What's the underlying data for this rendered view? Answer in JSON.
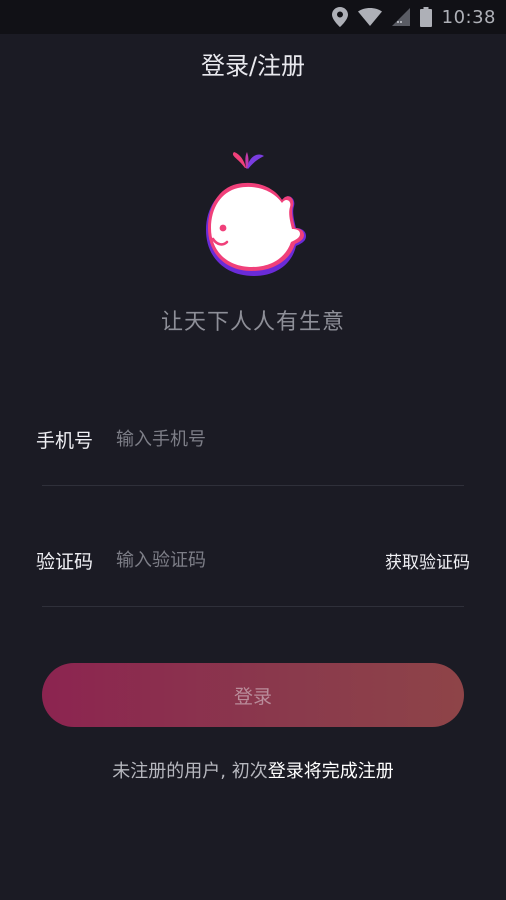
{
  "status_bar": {
    "time": "10:38",
    "icons": [
      "location-icon",
      "wifi-icon",
      "signal-icon",
      "battery-icon"
    ]
  },
  "header": {
    "title": "登录/注册"
  },
  "brand": {
    "logo": "whale-logo",
    "slogan": "让天下人人有生意"
  },
  "form": {
    "phone_label": "手机号",
    "phone_placeholder": "输入手机号",
    "phone_value": "",
    "code_label": "验证码",
    "code_placeholder": "输入验证码",
    "code_value": "",
    "get_code_label": "获取验证码",
    "submit_label": "登录"
  },
  "footer": {
    "hint_prefix": "未注册的用户, 初次",
    "hint_emphasis": "登录将完成注册"
  },
  "colors": {
    "background": "#1b1b24",
    "button_gradient_start": "#8c2450",
    "button_gradient_end": "#8e4448",
    "logo_pink": "#f0407a",
    "logo_purple": "#6a2bd8"
  }
}
